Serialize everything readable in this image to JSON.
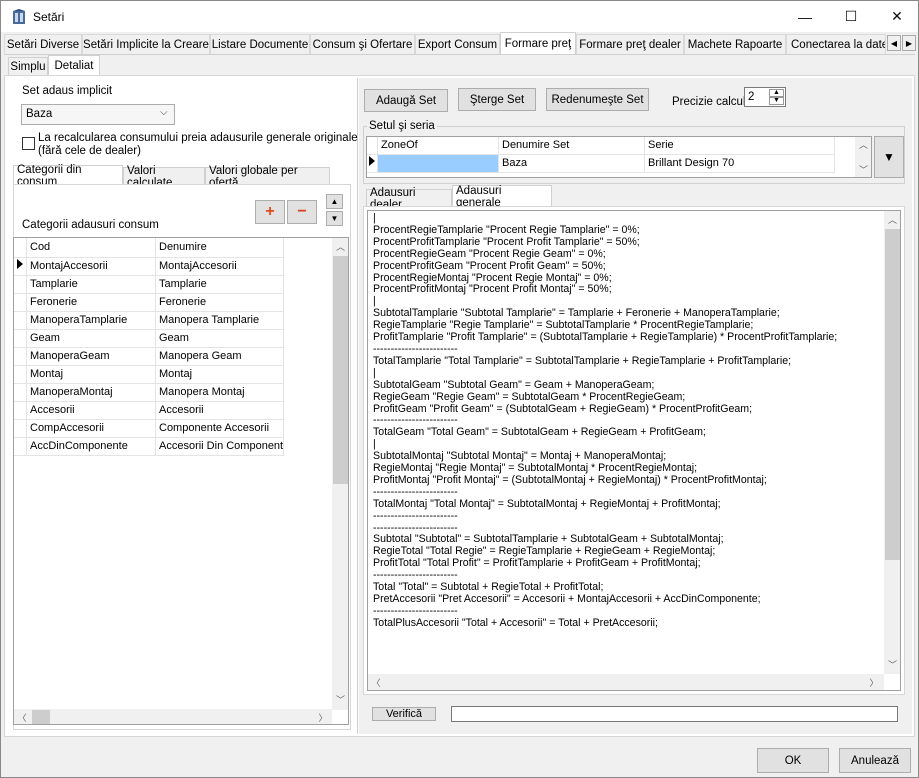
{
  "window": {
    "title": "Setări",
    "minimize": "—",
    "maximize": "☐",
    "close": "✕"
  },
  "main_tabs": [
    "Setări Diverse",
    "Setări Implicite la Creare",
    "Listare Documente",
    "Consum şi Ofertare",
    "Export Consum",
    "Formare preţ",
    "Formare preţ dealer",
    "Machete Rapoarte",
    "Conectarea la date"
  ],
  "main_tab_selected": 5,
  "sub_tabs": [
    "Simplu",
    "Detaliat"
  ],
  "left": {
    "set_label": "Set adaus implicit",
    "set_value": "Baza",
    "checkbox_text": "La recalcularea consumului preia adausurile generale originale\n(fără cele de dealer)",
    "checkbox_checked": false,
    "inner_tabs": [
      "Categorii din consum",
      "Valori calculate",
      "Valori globale per ofertă"
    ],
    "categories_label": "Categorii adausuri consum",
    "add_glyph": "+",
    "remove_glyph": "−",
    "columns": [
      "Cod",
      "Denumire"
    ],
    "rows": [
      [
        "MontajAccesorii",
        "MontajAccesorii"
      ],
      [
        "Tamplarie",
        "Tamplarie"
      ],
      [
        "Feronerie",
        "Feronerie"
      ],
      [
        "ManoperaTamplarie",
        "Manopera Tamplarie"
      ],
      [
        "Geam",
        "Geam"
      ],
      [
        "ManoperaGeam",
        "Manopera Geam"
      ],
      [
        "Montaj",
        "Montaj"
      ],
      [
        "ManoperaMontaj",
        "Manopera Montaj"
      ],
      [
        "Accesorii",
        "Accesorii"
      ],
      [
        "CompAccesorii",
        "Componente Accesorii"
      ],
      [
        "AccDinComponente",
        "Accesorii Din Componente"
      ]
    ]
  },
  "right": {
    "add_set": "Adaugă Set",
    "delete_set": "Şterge Set",
    "rename_set": "Redenumeşte Set",
    "precision_label": "Precizie calcul:",
    "precision_value": "2",
    "group_label": "Setul şi seria",
    "set_columns": [
      "ZoneOf",
      "Denumire Set",
      "Serie"
    ],
    "set_row": [
      "",
      "Baza",
      "Brillant Design 70"
    ],
    "inner_tabs": [
      "Adausuri dealer",
      "Adausuri generale"
    ],
    "formulas": "|\nProcentRegieTamplarie \"Procent Regie Tamplarie\" = 0%;\nProcentProfitTamplarie \"Procent Profit Tamplarie\" = 50%;\nProcentRegieGeam \"Procent Regie Geam\" = 0%;\nProcentProfitGeam \"Procent Profit Geam\" = 50%;\nProcentRegieMontaj \"Procent Regie Montaj\" = 0%;\nProcentProfitMontaj \"Procent Profit Montaj\" = 50%;\n|\nSubtotalTamplarie \"Subtotal Tamplarie\" = Tamplarie + Feronerie + ManoperaTamplarie;\nRegieTamplarie \"Regie Tamplarie\" = SubtotalTamplarie * ProcentRegieTamplarie;\nProfitTamplarie \"Profit Tamplarie\" = (SubtotalTamplarie + RegieTamplarie) * ProcentProfitTamplarie;\n------------------------\nTotalTamplarie \"Total Tamplarie\" = SubtotalTamplarie + RegieTamplarie + ProfitTamplarie;\n|\nSubtotalGeam \"Subtotal Geam\" = Geam + ManoperaGeam;\nRegieGeam \"Regie Geam\" = SubtotalGeam * ProcentRegieGeam;\nProfitGeam \"Profit Geam\" = (SubtotalGeam + RegieGeam) * ProcentProfitGeam;\n------------------------\nTotalGeam \"Total Geam\" = SubtotalGeam + RegieGeam + ProfitGeam;\n|\nSubtotalMontaj \"Subtotal Montaj\" = Montaj + ManoperaMontaj;\nRegieMontaj \"Regie Montaj\" = SubtotalMontaj * ProcentRegieMontaj;\nProfitMontaj \"Profit Montaj\" = (SubtotalMontaj + RegieMontaj) * ProcentProfitMontaj;\n------------------------\nTotalMontaj \"Total Montaj\" = SubtotalMontaj + RegieMontaj + ProfitMontaj;\n------------------------\n------------------------\nSubtotal \"Subtotal\" = SubtotalTamplarie + SubtotalGeam + SubtotalMontaj;\nRegieTotal \"Total Regie\" = RegieTamplarie + RegieGeam + RegieMontaj;\nProfitTotal \"Total Profit\" = ProfitTamplarie + ProfitGeam + ProfitMontaj;\n------------------------\nTotal \"Total\" = Subtotal + RegieTotal + ProfitTotal;\nPretAccesorii \"Pret Accesorii\" = Accesorii + MontajAccesorii + AccDinComponente;\n------------------------\nTotalPlusAccesorii \"Total + Accesorii\" = Total + PretAccesorii;",
    "verify": "Verifică",
    "verify_result": ""
  },
  "footer": {
    "ok": "OK",
    "cancel": "Anulează"
  }
}
